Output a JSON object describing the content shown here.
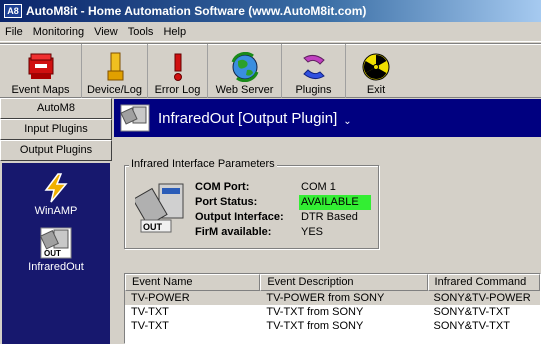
{
  "window": {
    "icon_text": "A8",
    "title": "AutoM8it - Home Automation Software (www.AutoM8it.com)"
  },
  "menu": [
    "File",
    "Monitoring",
    "View",
    "Tools",
    "Help"
  ],
  "toolbar": [
    {
      "label": "Event Maps",
      "icon": "event-maps-icon"
    },
    {
      "label": "Device/Log",
      "icon": "device-log-icon"
    },
    {
      "label": "Error Log",
      "icon": "error-log-icon"
    },
    {
      "label": "Web Server",
      "icon": "web-server-icon"
    },
    {
      "label": "Plugins",
      "icon": "plugins-icon"
    },
    {
      "label": "Exit",
      "icon": "exit-icon"
    }
  ],
  "nav": {
    "tabs": [
      "AutoM8",
      "Input Plugins",
      "Output Plugins"
    ],
    "plugins": [
      {
        "label": "WinAMP",
        "icon": "winamp-icon"
      },
      {
        "label": "InfraredOut",
        "icon": "infrared-out-icon",
        "icon_text": "OUT"
      }
    ]
  },
  "main": {
    "title": "InfraredOut [Output Plugin]",
    "caret": "⌄",
    "group": {
      "legend": "Infrared Interface Parameters",
      "icon_text": "OUT",
      "params": [
        {
          "key": "COM Port:",
          "value": "COM 1"
        },
        {
          "key": "Port Status:",
          "value": "AVAILABLE"
        },
        {
          "key": "Output Interface:",
          "value": "DTR Based"
        },
        {
          "key": "FirM available:",
          "value": "YES"
        }
      ]
    },
    "table": {
      "columns": [
        "Event Name",
        "Event Description",
        "Infrared Command"
      ],
      "rows": [
        [
          "TV-POWER",
          "TV-POWER from SONY",
          "SONY&TV-POWER"
        ],
        [
          "TV-TXT",
          "TV-TXT from SONY",
          "SONY&TV-TXT"
        ],
        [
          "TV-TXT",
          "TV-TXT from SONY",
          "SONY&TV-TXT"
        ]
      ]
    }
  },
  "colors": {
    "title_bar": "#0a246a",
    "nav_panel": "#17186e",
    "header_band": "#000080",
    "available_highlight": "#33ee33"
  }
}
